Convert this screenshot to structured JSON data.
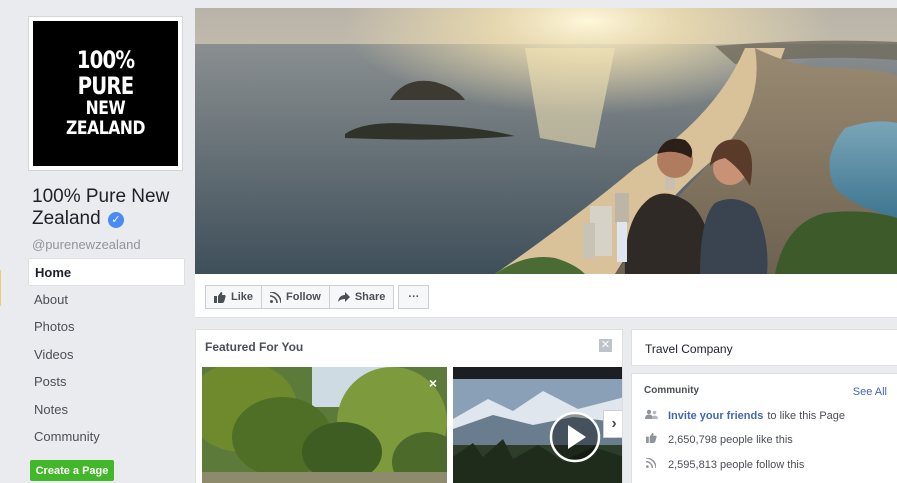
{
  "profile": {
    "logo_line1": "100% PURE",
    "logo_line2": "NEW ZEALAND",
    "name": "100% Pure New Zealand",
    "verified_glyph": "✓",
    "handle": "@purenewzealand"
  },
  "nav": {
    "items": [
      {
        "label": "Home",
        "active": true
      },
      {
        "label": "About"
      },
      {
        "label": "Photos"
      },
      {
        "label": "Videos"
      },
      {
        "label": "Posts"
      },
      {
        "label": "Notes"
      },
      {
        "label": "Community"
      }
    ],
    "create_page": "Create a Page"
  },
  "actions": {
    "like": "Like",
    "follow": "Follow",
    "share": "Share",
    "more": "···",
    "icons": {
      "like": "thumbs-up-icon",
      "follow": "rss-icon",
      "share": "share-arrow-icon"
    }
  },
  "featured": {
    "title": "Featured For You",
    "close": "✕",
    "thumb_close": "×",
    "next": "›"
  },
  "sidebar": {
    "category": "Travel Company",
    "community_title": "Community",
    "see_all": "See All",
    "invite_link": "Invite your friends",
    "invite_rest": "to like this Page",
    "likes": "2,650,798 people like this",
    "follows": "2,595,813 people follow this"
  },
  "colors": {
    "background": "#e9ebee",
    "link": "#4267b2",
    "verified": "#4a8af4",
    "create_button": "#42b72a"
  }
}
